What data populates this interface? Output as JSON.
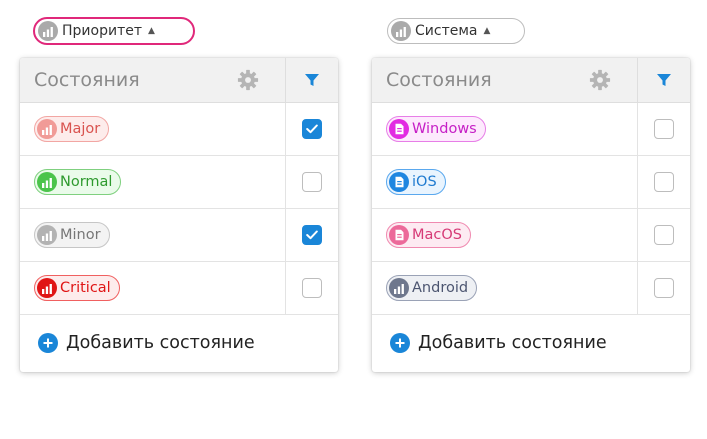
{
  "colors": {
    "accent": "#1a86d8",
    "trigger_active_border": "#e0287a",
    "trigger_inactive_border": "#bdbdbd"
  },
  "left": {
    "trigger": {
      "label": "Приоритет",
      "icon": "signal-bars-icon",
      "active": true,
      "badge_color": "#aaaaaa"
    },
    "panel": {
      "title": "Состояния",
      "settings_icon": "gear-icon",
      "filter_icon": "filter-icon",
      "add_label": "Добавить состояние",
      "items": [
        {
          "label": "Major",
          "icon": "signal-bars-icon",
          "text": "#d9534f",
          "border": "#f2a6a3",
          "bg": "#fdeceb",
          "badge": "#f19b97",
          "checked": true
        },
        {
          "label": "Normal",
          "icon": "signal-bars-icon",
          "text": "#2e9a2e",
          "border": "#7fd07f",
          "bg": "#eafbea",
          "badge": "#4cc44c",
          "checked": false
        },
        {
          "label": "Minor",
          "icon": "signal-bars-icon",
          "text": "#777777",
          "border": "#c6c6c6",
          "bg": "#f3f3f3",
          "badge": "#b3b3b3",
          "checked": true
        },
        {
          "label": "Critical",
          "icon": "signal-bars-icon",
          "text": "#e01515",
          "border": "#f06060",
          "bg": "#fdecec",
          "badge": "#e01515",
          "checked": false
        }
      ]
    }
  },
  "right": {
    "trigger": {
      "label": "Система",
      "icon": "signal-bars-icon",
      "active": false,
      "badge_color": "#aaaaaa"
    },
    "panel": {
      "title": "Состояния",
      "settings_icon": "gear-icon",
      "filter_icon": "filter-icon",
      "add_label": "Добавить состояние",
      "items": [
        {
          "label": "Windows",
          "icon": "document-icon",
          "text": "#c620c6",
          "border": "#e77ee7",
          "bg": "#fdeafd",
          "badge": "#e22be2",
          "checked": false
        },
        {
          "label": "iOS",
          "icon": "document-icon",
          "text": "#1f7bd0",
          "border": "#5aa8ee",
          "bg": "#e9f4fe",
          "badge": "#1f86e0",
          "checked": false
        },
        {
          "label": "MacOS",
          "icon": "document-icon",
          "text": "#d63a76",
          "border": "#f08ab0",
          "bg": "#fdebf2",
          "badge": "#ec6a9a",
          "checked": false
        },
        {
          "label": "Android",
          "icon": "signal-bars-icon",
          "text": "#4c5570",
          "border": "#9aa2b6",
          "bg": "#eef0f4",
          "badge": "#6e778d",
          "checked": false
        }
      ]
    }
  }
}
